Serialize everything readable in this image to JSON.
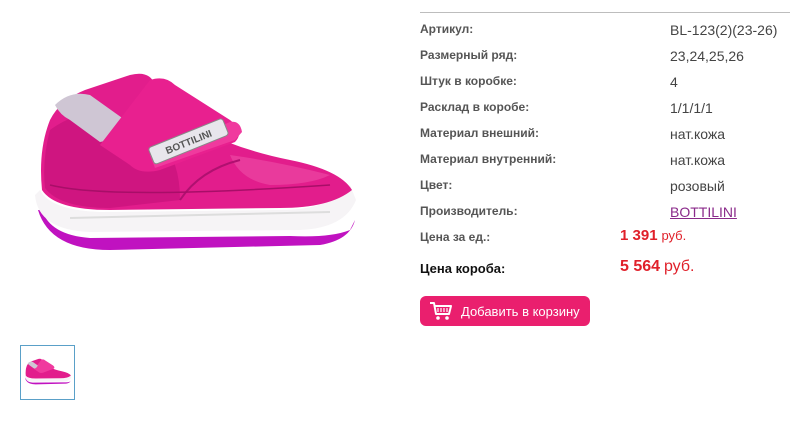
{
  "product": {
    "image_alt": "pink sneaker",
    "logo_text": "BOTTILINI"
  },
  "specs": [
    {
      "label": "Артикул:",
      "value": "BL-123(2)(23-26)"
    },
    {
      "label": "Размерный ряд:",
      "value": "23,24,25,26"
    },
    {
      "label": "Штук в коробке:",
      "value": "4"
    },
    {
      "label": "Расклад в коробе:",
      "value": "1/1/1/1"
    },
    {
      "label": "Материал внешний:",
      "value": "нат.кожа"
    },
    {
      "label": "Материал внутренний:",
      "value": "нат.кожа"
    },
    {
      "label": "Цвет:",
      "value": "розовый"
    },
    {
      "label": "Производитель:",
      "value": "BOTTILINI"
    }
  ],
  "unit_price": {
    "label": "Цена за ед.:",
    "amount": "1 391",
    "currency": "руб."
  },
  "box_price": {
    "label": "Цена короба:",
    "amount": "5 564",
    "currency": "руб."
  },
  "cart_button": {
    "label": "Добавить в корзину",
    "icon": "cart-icon"
  },
  "colors": {
    "accent": "#ea1f6e",
    "price": "#e0202a",
    "link": "#8a2a8a"
  }
}
